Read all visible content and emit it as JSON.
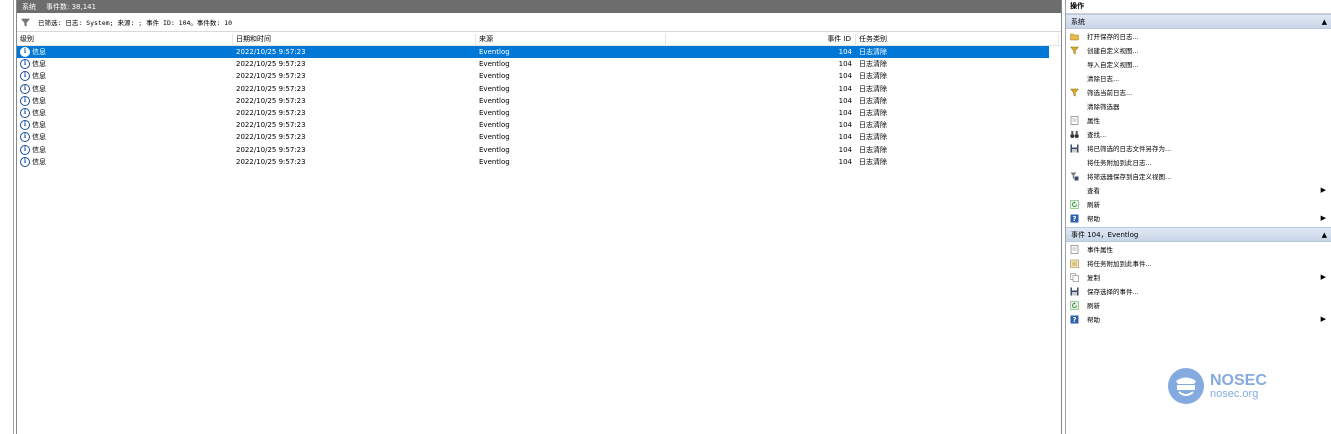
{
  "header": {
    "log_name": "系统",
    "event_count_label": "事件数: 38,141"
  },
  "filter": {
    "text": "已筛选: 日志: System; 来源: ; 事件 ID: 104。事件数: 10"
  },
  "columns": [
    "级别",
    "日期和时间",
    "来源",
    "事件 ID",
    "任务类别"
  ],
  "rows": [
    {
      "level": "信息",
      "datetime": "2022/10/25 9:57:23",
      "source": "Eventlog",
      "id": "104",
      "category": "日志清除"
    },
    {
      "level": "信息",
      "datetime": "2022/10/25 9:57:23",
      "source": "Eventlog",
      "id": "104",
      "category": "日志清除"
    },
    {
      "level": "信息",
      "datetime": "2022/10/25 9:57:23",
      "source": "Eventlog",
      "id": "104",
      "category": "日志清除"
    },
    {
      "level": "信息",
      "datetime": "2022/10/25 9:57:23",
      "source": "Eventlog",
      "id": "104",
      "category": "日志清除"
    },
    {
      "level": "信息",
      "datetime": "2022/10/25 9:57:23",
      "source": "Eventlog",
      "id": "104",
      "category": "日志清除"
    },
    {
      "level": "信息",
      "datetime": "2022/10/25 9:57:23",
      "source": "Eventlog",
      "id": "104",
      "category": "日志清除"
    },
    {
      "level": "信息",
      "datetime": "2022/10/25 9:57:23",
      "source": "Eventlog",
      "id": "104",
      "category": "日志清除"
    },
    {
      "level": "信息",
      "datetime": "2022/10/25 9:57:23",
      "source": "Eventlog",
      "id": "104",
      "category": "日志清除"
    },
    {
      "level": "信息",
      "datetime": "2022/10/25 9:57:23",
      "source": "Eventlog",
      "id": "104",
      "category": "日志清除"
    },
    {
      "level": "信息",
      "datetime": "2022/10/25 9:57:23",
      "source": "Eventlog",
      "id": "104",
      "category": "日志清除"
    }
  ],
  "actions": {
    "title": "操作",
    "section1": "系统",
    "items1": [
      {
        "label": "打开保存的日志...",
        "icon": "open-folder-icon"
      },
      {
        "label": "创建自定义视图...",
        "icon": "filter-funnel-icon"
      },
      {
        "label": "导入自定义视图...",
        "icon": ""
      },
      {
        "label": "清除日志...",
        "icon": ""
      },
      {
        "label": "筛选当前日志...",
        "icon": "filter-funnel-icon"
      },
      {
        "label": "清除筛选器",
        "icon": ""
      },
      {
        "label": "属性",
        "icon": "properties-icon"
      },
      {
        "label": "查找...",
        "icon": "binoculars-icon"
      },
      {
        "label": "将已筛选的日志文件另存为...",
        "icon": "save-icon"
      },
      {
        "label": "将任务附加到此日志...",
        "icon": ""
      },
      {
        "label": "将筛选器保存到自定义视图...",
        "icon": "filter-save-icon"
      },
      {
        "label": "查看",
        "icon": "",
        "arrow": "▶"
      },
      {
        "label": "刷新",
        "icon": "refresh-icon"
      },
      {
        "label": "帮助",
        "icon": "help-icon",
        "arrow": "▶"
      }
    ],
    "section2": "事件 104，Eventlog",
    "items2": [
      {
        "label": "事件属性",
        "icon": "properties-icon"
      },
      {
        "label": "将任务附加到此事件...",
        "icon": "task-icon"
      },
      {
        "label": "复制",
        "icon": "copy-icon",
        "arrow": "▶"
      },
      {
        "label": "保存选择的事件...",
        "icon": "save-icon"
      },
      {
        "label": "刷新",
        "icon": "refresh-icon"
      },
      {
        "label": "帮助",
        "icon": "help-icon",
        "arrow": "▶"
      }
    ],
    "collapse_glyph": "▲"
  },
  "watermark": {
    "brand": "NOSEC",
    "site": "nosec.org"
  },
  "colors": {
    "selection": "#0078d7",
    "titlebar": "#6d6d6d",
    "section_bg": "#c7d5e8"
  }
}
